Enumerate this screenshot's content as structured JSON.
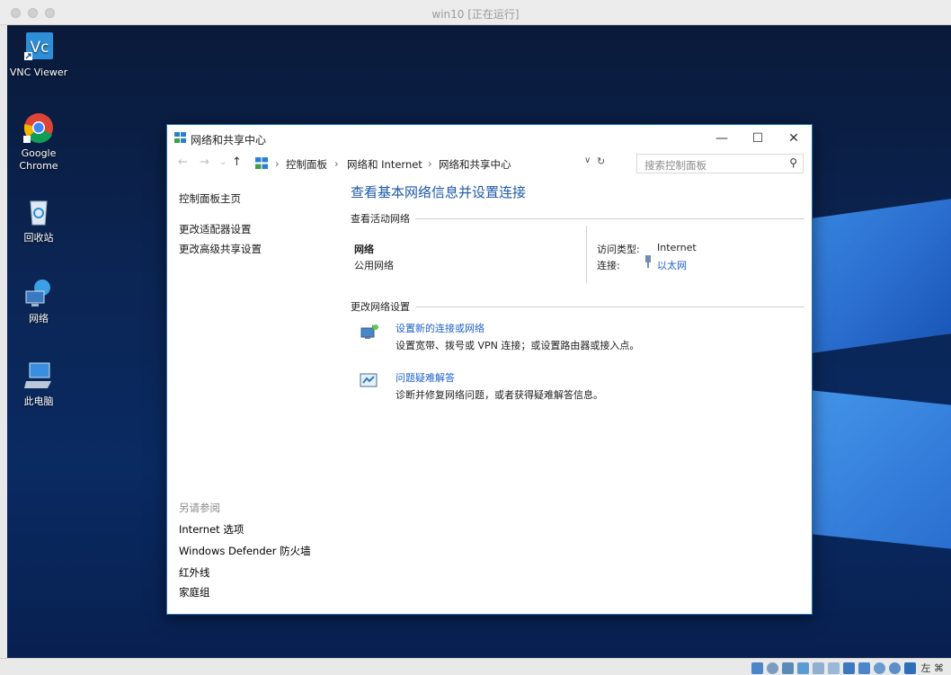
{
  "host": {
    "window_title": "win10 [正在运行]"
  },
  "desktop": {
    "icons": [
      {
        "label": "VNC Viewer"
      },
      {
        "label": "Google Chrome"
      },
      {
        "label": "回收站"
      },
      {
        "label": "网络"
      },
      {
        "label": "此电脑"
      }
    ]
  },
  "window": {
    "title": "网络和共享中心",
    "controls": {
      "minimize": "—",
      "maximize": "☐",
      "close": "✕"
    },
    "nav": {
      "back": "←",
      "forward": "→",
      "recent": "⌄",
      "up": "↑"
    },
    "breadcrumb": [
      "控制面板",
      "网络和 Internet",
      "网络和共享中心"
    ],
    "search_placeholder": "搜索控制面板",
    "sidebar": {
      "home": "控制面板主页",
      "links": [
        "更改适配器设置",
        "更改高级共享设置"
      ],
      "see_also_title": "另请参阅",
      "see_also": [
        "Internet 选项",
        "Windows Defender 防火墙",
        "红外线",
        "家庭组"
      ]
    },
    "main": {
      "heading": "查看基本网络信息并设置连接",
      "active_section": "查看活动网络",
      "network_name": "网络",
      "network_type": "公用网络",
      "access_type_label": "访问类型:",
      "access_type_value": "Internet",
      "connection_label": "连接:",
      "connection_value": "以太网",
      "change_section": "更改网络设置",
      "tasks": [
        {
          "title": "设置新的连接或网络",
          "desc": "设置宽带、拨号或 VPN 连接；或设置路由器或接入点。"
        },
        {
          "title": "问题疑难解答",
          "desc": "诊断并修复网络问题，或者获得疑难解答信息。"
        }
      ]
    }
  },
  "statusbar": {
    "host_key": "左 ⌘"
  },
  "colors": {
    "link": "#1e62c8",
    "heading": "#1e5aa8",
    "window_border": "#1e73be"
  }
}
